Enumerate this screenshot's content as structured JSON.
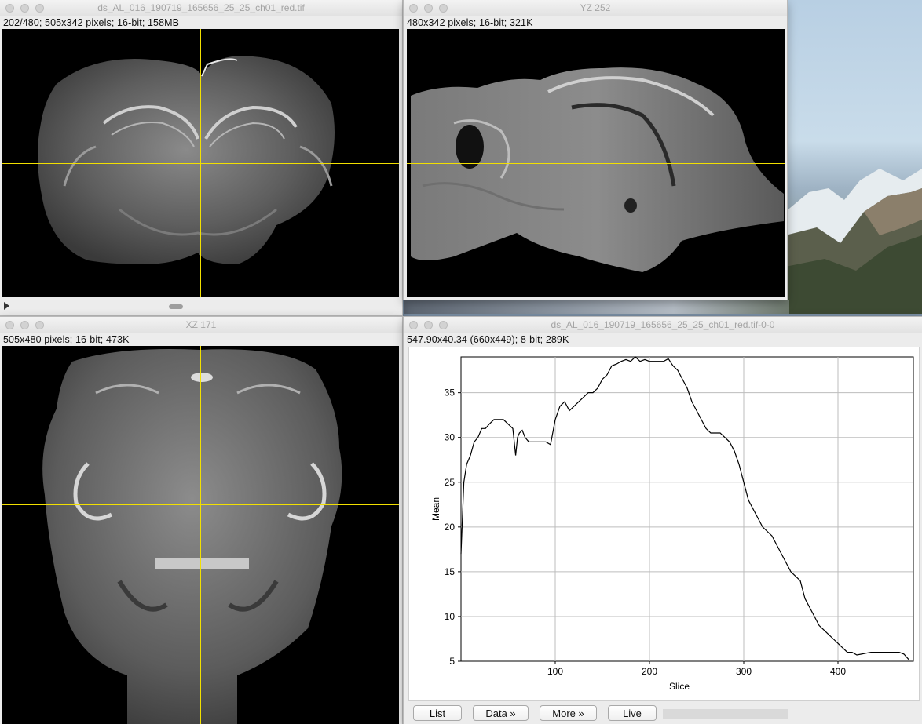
{
  "windows": {
    "main": {
      "title": "ds_AL_016_190719_165656_25_25_ch01_red.tif",
      "info": "202/480; 505x342 pixels; 16-bit; 158MB"
    },
    "yz": {
      "title": "YZ 252",
      "info": "480x342 pixels; 16-bit; 321K"
    },
    "xz": {
      "title": "XZ 171",
      "info": "505x480 pixels; 16-bit; 473K"
    },
    "plot": {
      "title": "ds_AL_016_190719_165656_25_25_ch01_red.tif-0-0",
      "info": "547.90x40.34    (660x449); 8-bit; 289K",
      "buttons": {
        "list": "List",
        "data": "Data »",
        "more": "More »",
        "live": "Live"
      }
    }
  },
  "crosshair_color": "#f2e000",
  "icons": [
    "play-icon",
    "close-icon",
    "minimize-icon",
    "zoom-icon"
  ],
  "chart_data": {
    "type": "line",
    "title": "",
    "xlabel": "Slice",
    "ylabel": "Mean",
    "xlim": [
      0,
      480
    ],
    "ylim": [
      5,
      39
    ],
    "xticks": [
      "100",
      "200",
      "300",
      "400"
    ],
    "yticks": [
      "5",
      "10",
      "15",
      "20",
      "25",
      "30",
      "35"
    ],
    "grid": true,
    "series": [
      {
        "x": [
          0,
          3,
          6,
          10,
          14,
          18,
          22,
          26,
          30,
          35,
          40,
          45,
          50,
          55,
          58,
          60,
          62,
          65,
          68,
          72,
          76,
          80,
          85,
          90,
          95,
          100,
          105,
          110,
          115,
          120,
          125,
          130,
          135,
          140,
          145,
          150,
          155,
          160,
          165,
          170,
          175,
          180,
          185,
          190,
          195,
          200,
          205,
          210,
          215,
          220,
          225,
          230,
          235,
          240,
          245,
          250,
          255,
          260,
          265,
          270,
          275,
          280,
          285,
          290,
          295,
          300,
          305,
          310,
          315,
          320,
          325,
          330,
          335,
          340,
          345,
          350,
          355,
          360,
          365,
          370,
          375,
          380,
          385,
          390,
          395,
          400,
          405,
          410,
          415,
          420,
          425,
          430,
          435,
          440,
          445,
          450,
          455,
          460,
          465,
          470,
          475
        ],
        "y": [
          17,
          25,
          27,
          28,
          29.5,
          30,
          31,
          31,
          31.5,
          32,
          32,
          32,
          31.5,
          31,
          28,
          30,
          30.5,
          30.8,
          30,
          29.5,
          29.5,
          29.5,
          29.5,
          29.5,
          29.2,
          32,
          33.5,
          34,
          33,
          33.5,
          34,
          34.5,
          35,
          35,
          35.5,
          36.5,
          37,
          38,
          38.2,
          38.5,
          38.7,
          38.5,
          39,
          38.5,
          38.7,
          38.5,
          38.5,
          38.5,
          38.5,
          38.8,
          38,
          37.5,
          36.5,
          35.5,
          34,
          33,
          32,
          31,
          30.5,
          30.5,
          30.5,
          30,
          29.5,
          28.5,
          27,
          25,
          23,
          22,
          21,
          20,
          19.5,
          19,
          18,
          17,
          16,
          15,
          14.5,
          14,
          12,
          11,
          10,
          9,
          8.5,
          8,
          7.5,
          7,
          6.5,
          6,
          6,
          5.7,
          5.8,
          5.9,
          6,
          6,
          6,
          6,
          6,
          6,
          6,
          5.8,
          5.2
        ]
      }
    ]
  }
}
